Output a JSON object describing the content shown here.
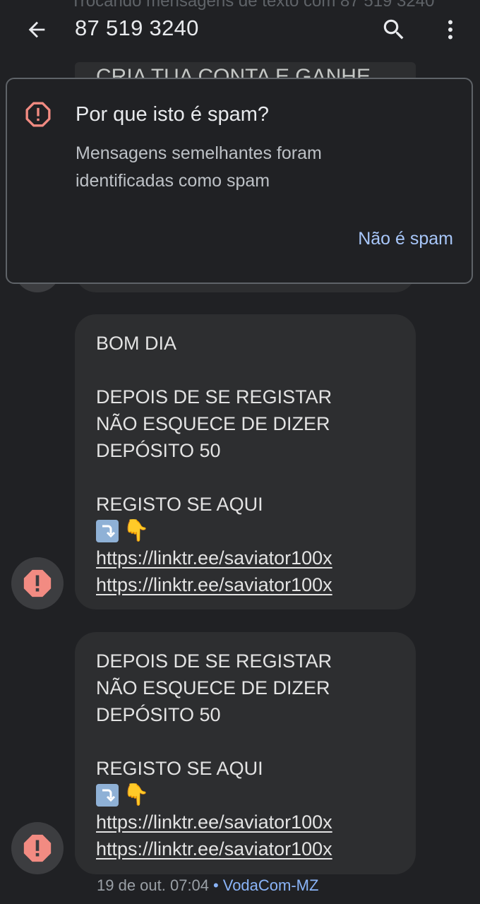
{
  "header": {
    "faded_text": "Trocando mensagens de texto com 87 519 3240",
    "title": "87 519 3240",
    "icons": {
      "back": "arrow-back-icon",
      "search": "search-icon",
      "more": "more-vert-icon"
    }
  },
  "hidden_message_peek": "CRIA TUA CONTA E GANHE",
  "spam_dialog": {
    "icon": "spam-alert-icon",
    "title": "Por que isto é spam?",
    "body": "Mensagens semelhantes foram identificadas como spam",
    "action_label": "Não é spam",
    "colors": {
      "icon": "#f28b82",
      "action": "#a8c7fa",
      "border": "#5f6368"
    }
  },
  "messages": [
    {
      "lines": [
        "BOM DIA",
        "",
        "DEPOIS DE SE REGISTAR",
        "NÃO ESQUECE DE DIZER",
        "DEPÓSITO 50",
        "",
        "REGISTO SE AQUI"
      ],
      "emoji": [
        "arrow-down-right-emoji",
        "pointing-down-hand-emoji"
      ],
      "links": [
        "https://linktr.ee/saviator100x",
        "https://linktr.ee/saviator100x"
      ]
    },
    {
      "lines": [
        "DEPOIS DE SE REGISTAR",
        "NÃO ESQUECE DE DIZER",
        "DEPÓSITO 50",
        "",
        "REGISTO SE AQUI"
      ],
      "emoji": [
        "arrow-down-right-emoji",
        "pointing-down-hand-emoji"
      ],
      "links": [
        "https://linktr.ee/saviator100x",
        "https://linktr.ee/saviator100x"
      ]
    }
  ],
  "meta": {
    "timestamp": "19 de out. 07:04",
    "separator": "•",
    "carrier": "VodaCom-MZ"
  },
  "colors": {
    "background": "#202124",
    "bubble": "#2d2e30",
    "avatar": "#3c3d40",
    "alert": "#f28b82",
    "link_accent": "#8ab4f8"
  }
}
